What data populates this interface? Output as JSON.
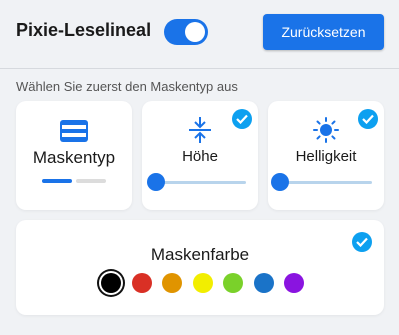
{
  "header": {
    "title": "Pixie-Leselineal",
    "toggle_on": true,
    "reset_label": "Zurücksetzen"
  },
  "section_label": "Wählen Sie zuerst den Maskentyp aus",
  "cards": {
    "mask_type": {
      "label": "Maskentyp",
      "icon": "mask-icon",
      "active_page": 1,
      "total_pages": 2
    },
    "height": {
      "label": "Höhe",
      "icon": "height-compress-icon",
      "checked": true,
      "value": 0
    },
    "brightness": {
      "label": "Helligkeit",
      "icon": "sun-icon",
      "checked": true,
      "value": 0
    }
  },
  "mask_color": {
    "label": "Maskenfarbe",
    "checked": true,
    "selected": "black",
    "colors": [
      {
        "name": "black",
        "hex": "#000000"
      },
      {
        "name": "red",
        "hex": "#d93025"
      },
      {
        "name": "orange",
        "hex": "#e09400"
      },
      {
        "name": "yellow",
        "hex": "#f2ee00"
      },
      {
        "name": "green",
        "hex": "#7ad12a"
      },
      {
        "name": "blue",
        "hex": "#1a73c8"
      },
      {
        "name": "purple",
        "hex": "#8a14e0"
      }
    ]
  },
  "colors": {
    "accent": "#1a73e8",
    "check": "#0da0f0",
    "background": "#f0f2f5"
  }
}
